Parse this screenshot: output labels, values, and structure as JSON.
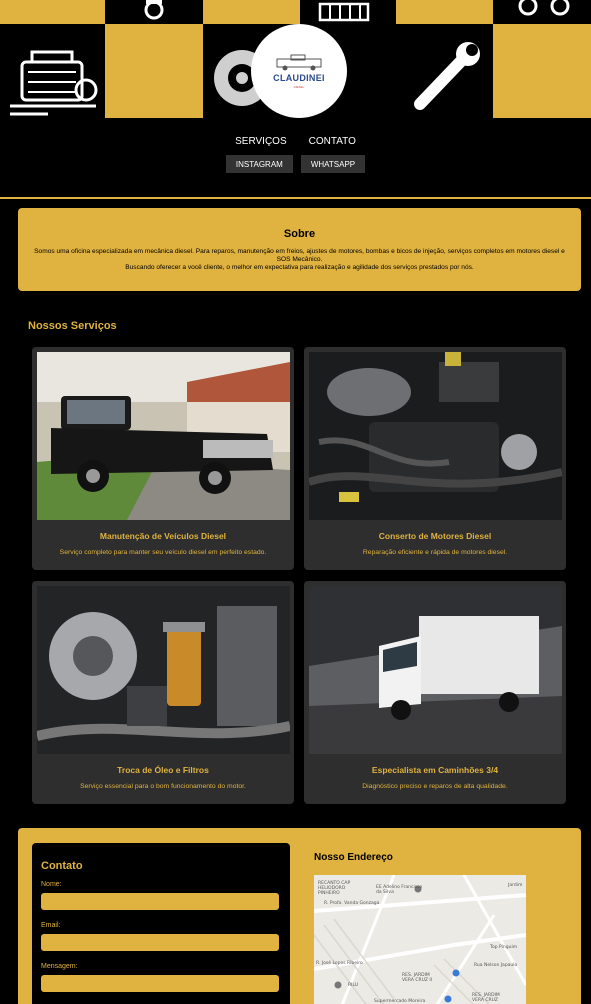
{
  "brand": {
    "name": "CLAUDINEI",
    "sub": "DIESEL"
  },
  "nav": {
    "links": [
      "SERVIÇOS",
      "CONTATO"
    ],
    "buttons": [
      "INSTAGRAM",
      "WHATSAPP"
    ]
  },
  "banner_icons": [
    "piston-icon",
    "engine-block-icon",
    "turbo-icon",
    "engine-icon",
    "brake-disc-icon",
    "wrench-icon"
  ],
  "sobre": {
    "title": "Sobre",
    "line1": "Somos uma oficina especializada em mecânica diesel. Para reparos, manutenção em freios, ajustes de motores, bombas e bicos de injeção, serviços completos em motores diesel e SOS Mecânico.",
    "line2": "Buscando oferecer a você cliente, o melhor em expectativa para realização e agilidade dos serviços prestados por nós."
  },
  "services": {
    "title": "Nossos Serviços",
    "items": [
      {
        "title": "Manutenção de Veículos Diesel",
        "desc": "Serviço completo para manter seu veículo diesel em perfeito estado."
      },
      {
        "title": "Conserto de Motores Diesel",
        "desc": "Reparação eficiente e rápida de motores diesel."
      },
      {
        "title": "Troca de Óleo e Filtros",
        "desc": "Serviço essencial para o bom funcionamento do motor."
      },
      {
        "title": "Especialista em Caminhões 3/4",
        "desc": "Diagnóstico preciso e reparos de alta qualidade."
      }
    ]
  },
  "contact": {
    "title": "Contato",
    "fields": [
      "Nome:",
      "Email:",
      "Mensagem:"
    ],
    "address_title": "Nosso Endereço"
  },
  "map_labels": [
    "RECANTO CAP HELIODORO PINHEIRO",
    "EE Adelino Francisco da Silva",
    "R. Profa. Vanda Gonzaga",
    "Jardim",
    "Top Pinguim",
    "Rua Nelson Japaulo",
    "R. José Lopes Ribeiro",
    "RES. JARDIM VERA CRUZ II",
    "RILU",
    "Supermercado Moreira",
    "RES. JARDIM VERA CRUZ"
  ],
  "colors": {
    "accent": "#e0b23f",
    "background": "#000000",
    "card": "#2e2e2e"
  }
}
